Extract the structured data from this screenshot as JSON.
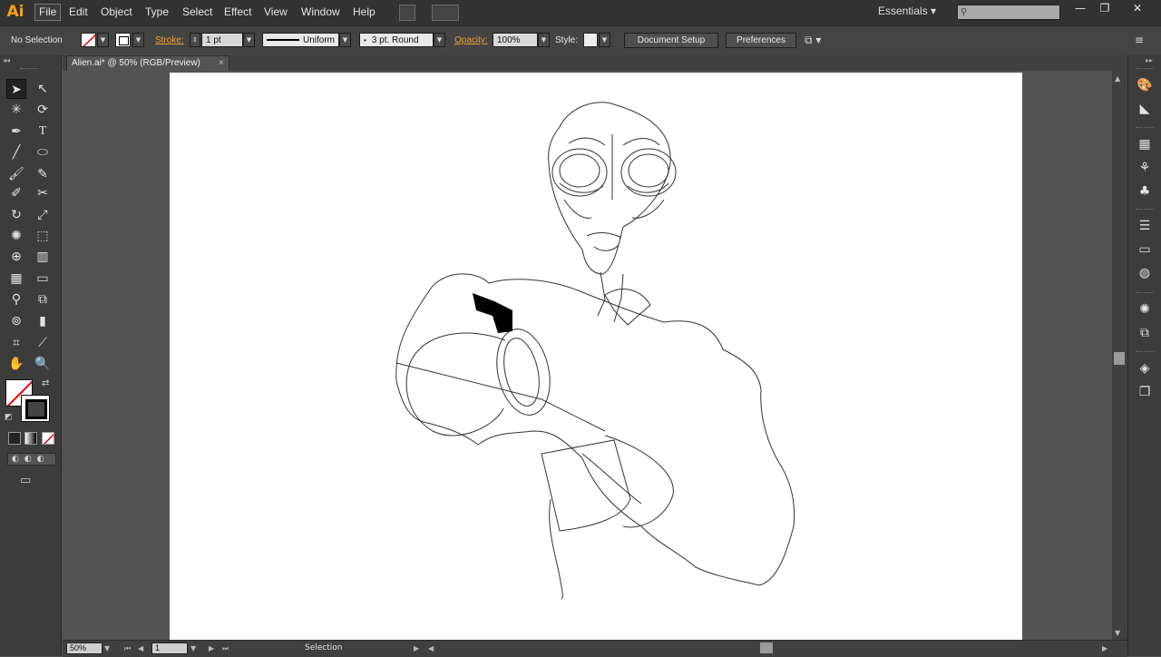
{
  "app": {
    "logo": "Ai"
  },
  "menu": [
    "File",
    "Edit",
    "Object",
    "Type",
    "Select",
    "Effect",
    "View",
    "Window",
    "Help"
  ],
  "workspace": {
    "label": "Essentials",
    "search_placeholder": ""
  },
  "window_controls": [
    "—",
    "❐",
    "✕"
  ],
  "control_bar": {
    "selection_label": "No Selection",
    "stroke_label": "Stroke:",
    "stroke_weight": "1 pt",
    "stroke_profile": "Uniform",
    "brush": "3 pt. Round",
    "opacity_label": "Opacity:",
    "opacity_value": "100%",
    "style_label": "Style:",
    "document_setup": "Document Setup",
    "preferences": "Preferences"
  },
  "document": {
    "tab_title": "Alien.ai* @ 50% (RGB/Preview)",
    "close": "×"
  },
  "status": {
    "zoom": "50%",
    "artboard": "1",
    "tool": "Selection"
  },
  "icons": {
    "fill": "fill-none-swatch",
    "stroke": "stroke-black-swatch"
  },
  "colors": {
    "accent": "#f0a030",
    "ui_bg": "#535353",
    "panel": "#3c3c3c"
  }
}
